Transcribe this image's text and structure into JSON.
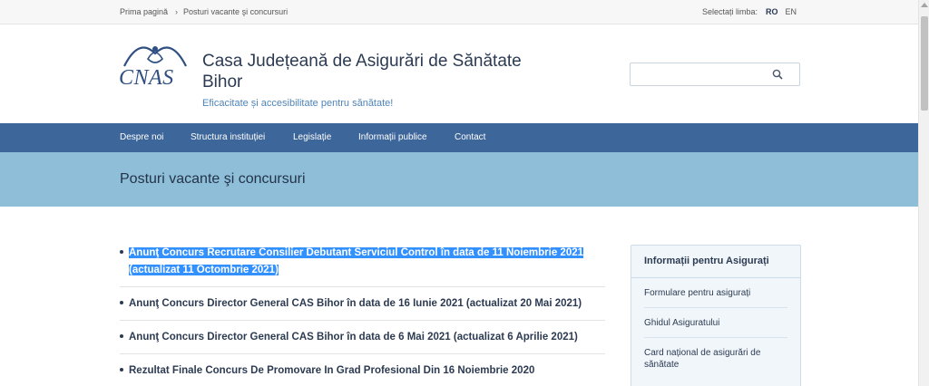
{
  "topbar": {
    "breadcrumb": [
      "Prima pagină",
      "Posturi vacante şi concursuri"
    ],
    "breadcrumb_sep": "›",
    "lang_label": "Selectați limba:",
    "lang_ro": "RO",
    "lang_en": "EN"
  },
  "header": {
    "logo_text": "CNAS",
    "title": "Casa Județeană de Asigurări de Sănătate Bihor",
    "slogan": "Eficacitate și accesibilitate pentru sănătate!",
    "search": {
      "placeholder": "",
      "value": ""
    }
  },
  "nav": {
    "items": [
      "Despre noi",
      "Structura instituției",
      "Legislație",
      "Informații publice",
      "Contact"
    ]
  },
  "page": {
    "title": "Posturi vacante şi concursuri"
  },
  "list": {
    "items": [
      "Anunţ Concurs Recrutare Consilier Debutant Serviciul Control în data de 11 Noiembrie 2021 (actualizat 11 Octombrie 2021)",
      "Anunţ Concurs Director General CAS Bihor în data de 16 Iunie 2021 (actualizat 20 Mai 2021)",
      "Anunţ Concurs Director General CAS Bihor în data de 6 Mai 2021 (actualizat 6 Aprilie 2021)",
      "Rezultat Finale Concurs De Promovare In Grad Profesional Din 16 Noiembrie 2020"
    ]
  },
  "sidebar": {
    "title": "Informații pentru Asigurați",
    "items": [
      "Formulare pentru asigurați",
      "Ghidul Asiguratului",
      "Card național de asigurări de sănătate"
    ]
  },
  "colors": {
    "nav_bg": "#3d669a",
    "title_band_bg": "#8fbfd8",
    "selection": "#3390ff",
    "brand": "#2f4f82"
  }
}
